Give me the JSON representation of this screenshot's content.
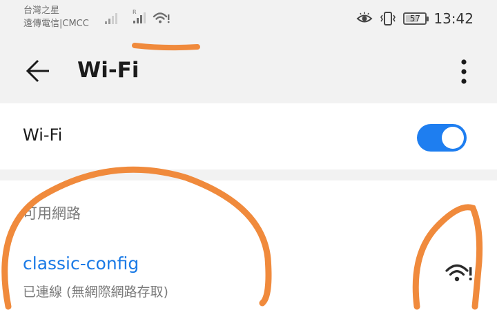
{
  "status_bar": {
    "carrier_line1": "台灣之星",
    "carrier_line2": "遠傳電信|CMCC",
    "roaming_label": "R",
    "battery_level": "57",
    "time": "13:42",
    "icons": [
      "signal-icon",
      "roaming-signal-icon",
      "wifi-alert-icon",
      "eye-comfort-icon",
      "vibrate-icon",
      "battery-icon"
    ]
  },
  "header": {
    "title": "Wi-Fi",
    "back_icon": "arrow-left-icon",
    "more_icon": "more-vertical-icon"
  },
  "wifi_toggle": {
    "label": "Wi-Fi",
    "state": "on",
    "accent_color": "#1e7ef0"
  },
  "networks_section": {
    "header": "可用網路",
    "items": [
      {
        "name": "classic-config",
        "status": "已連線 (無網際網路存取)",
        "signal_icon": "wifi-alert-icon"
      }
    ]
  },
  "colors": {
    "background": "#f2f2f2",
    "card": "#ffffff",
    "link_blue": "#1a7ae6",
    "annotation_orange": "#f08a3c"
  }
}
